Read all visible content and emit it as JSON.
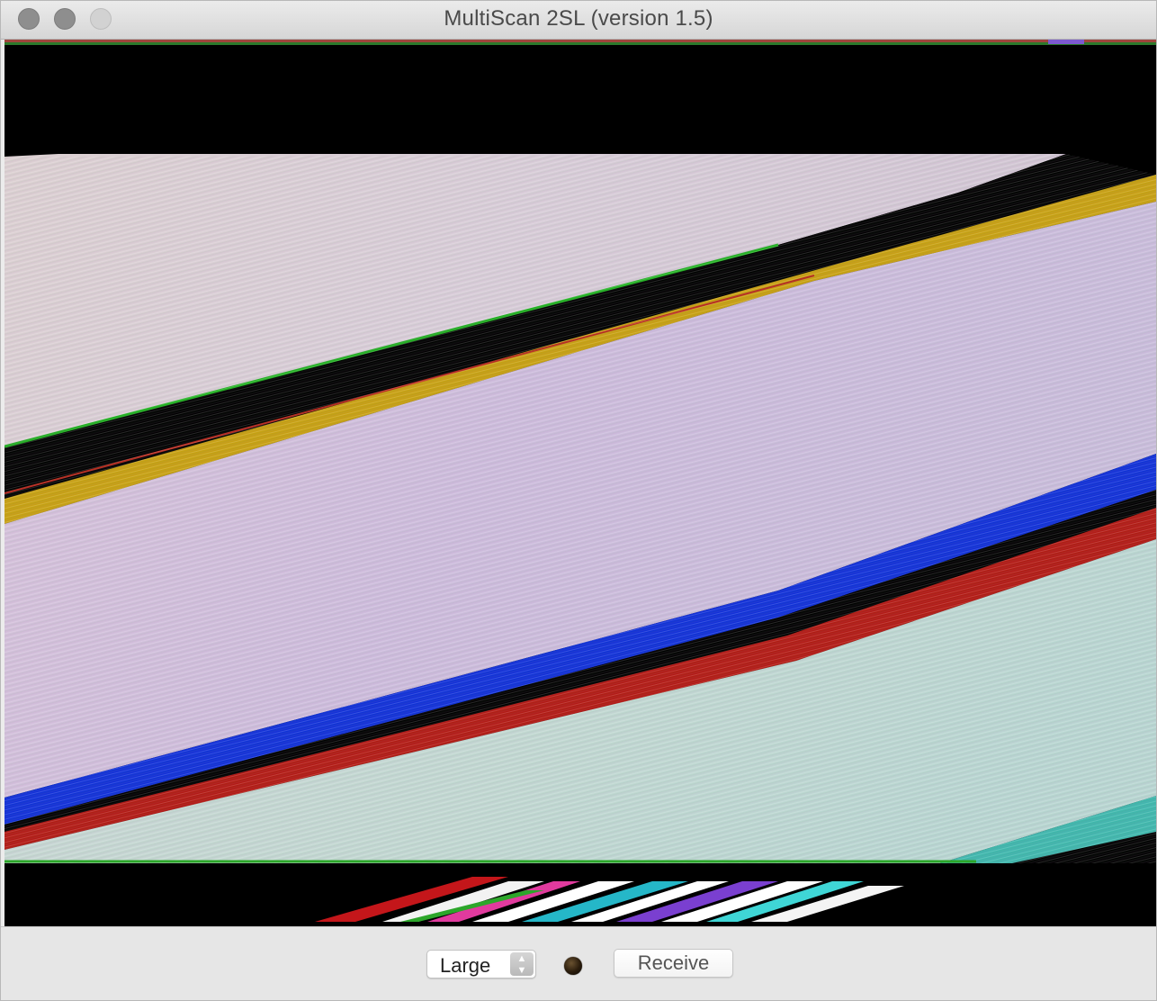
{
  "window": {
    "title": "MultiScan 2SL (version 1.5)"
  },
  "controls": {
    "size_select": {
      "selected": "Large"
    },
    "receive_button": {
      "label": "Receive"
    }
  },
  "colors": {
    "window_bg": "#ececec",
    "scan_bg": "#000000",
    "stripe_yellow": "#c7a011",
    "stripe_blue": "#1030d8",
    "stripe_red": "#b21a14",
    "stripe_green": "#2ca62a"
  },
  "icons": {
    "close": "close-icon",
    "minimize": "minimize-icon",
    "zoom": "zoom-icon",
    "stepper": "up-down-chevron-icon",
    "indicator": "status-indicator-icon"
  }
}
